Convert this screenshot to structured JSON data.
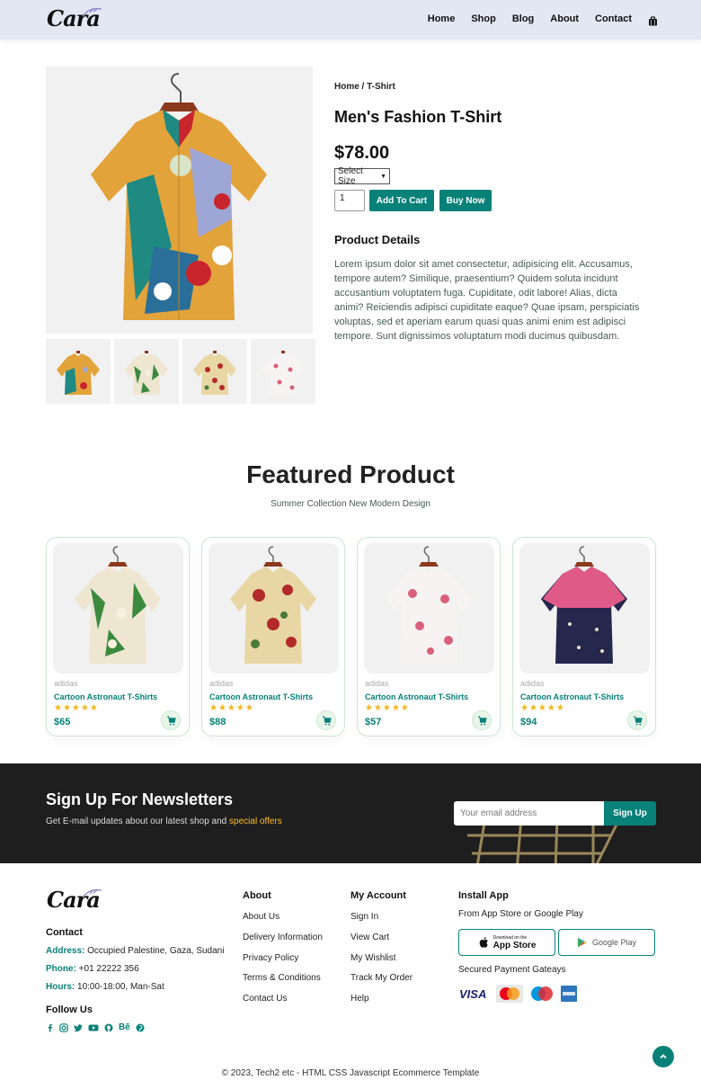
{
  "header": {
    "logo": "Cara",
    "nav": [
      "Home",
      "Shop",
      "Blog",
      "About",
      "Contact"
    ]
  },
  "product": {
    "breadcrumb": "Home / T-Shirt",
    "title": "Men's Fashion T-Shirt",
    "price": "$78.00",
    "size_select": "Select Size",
    "quantity": "1",
    "add_to_cart": "Add To Cart",
    "buy_now": "Buy Now",
    "details_heading": "Product Details",
    "details_text": "Lorem ipsum dolor sit amet consectetur, adipisicing elit. Accusamus, tempore autem? Similique, praesentium? Quidem soluta incidunt accusantium voluptatem fuga. Cupiditate, odit labore! Alias, dicta animi? Reiciendis adipisci cupiditate eaque? Quae ipsam, perspiciatis voluptas, sed et aperiam earum quasi quas animi enim est adipisci tempore. Sunt dignissimos voluptatum modi ducimus quibusdam."
  },
  "featured": {
    "title": "Featured Product",
    "subtitle": "Summer Collection New Modern Design",
    "cards": [
      {
        "brand": "adidas",
        "name": "Cartoon Astronaut T-Shirts",
        "stars": "★★★★★",
        "price": "$65"
      },
      {
        "brand": "adidas",
        "name": "Cartoon Astronaut T-Shirts",
        "stars": "★★★★★",
        "price": "$88"
      },
      {
        "brand": "adidas",
        "name": "Cartoon Astronaut T-Shirts",
        "stars": "★★★★★",
        "price": "$57"
      },
      {
        "brand": "adidas",
        "name": "Cartoon Astronaut T-Shirts",
        "stars": "★★★★★",
        "price": "$94"
      }
    ]
  },
  "newsletter": {
    "title": "Sign Up For Newsletters",
    "sub_text": "Get E-mail updates about our latest shop and",
    "sub_highlight": "special offers",
    "placeholder": "Your email address",
    "button": "Sign Up"
  },
  "footer": {
    "contact_heading": "Contact",
    "address_label": "Address:",
    "address": "Occupied Palestine, Gaza, Sudani",
    "phone_label": "Phone:",
    "phone": "+01 22222 356",
    "hours_label": "Hours:",
    "hours": "10:00-18:00, Man-Sat",
    "follow_heading": "Follow Us",
    "about_heading": "About",
    "about_links": [
      "About Us",
      "Delivery Information",
      "Privacy Policy",
      "Terms & Conditions",
      "Contact Us"
    ],
    "account_heading": "My Account",
    "account_links": [
      "Sign In",
      "View Cart",
      "My Wishlist",
      "Track My Order",
      "Help"
    ],
    "app_heading": "Install App",
    "app_sub": "From App Store or Google Play",
    "appstore_small": "Download on the",
    "appstore_big": "App Store",
    "googleplay": "Google Play",
    "payment_heading": "Secured Payment Gateays",
    "payments": [
      "VISA",
      "MasterCard",
      "Maestro",
      "AMEX"
    ],
    "copyright": "© 2023, Tech2 etc - HTML CSS Javascript Ecommerce Template"
  },
  "colors": {
    "accent": "#088178",
    "header_bg": "#e3e6f3",
    "star": "#f3b519",
    "highlight": "#ffbd27"
  }
}
